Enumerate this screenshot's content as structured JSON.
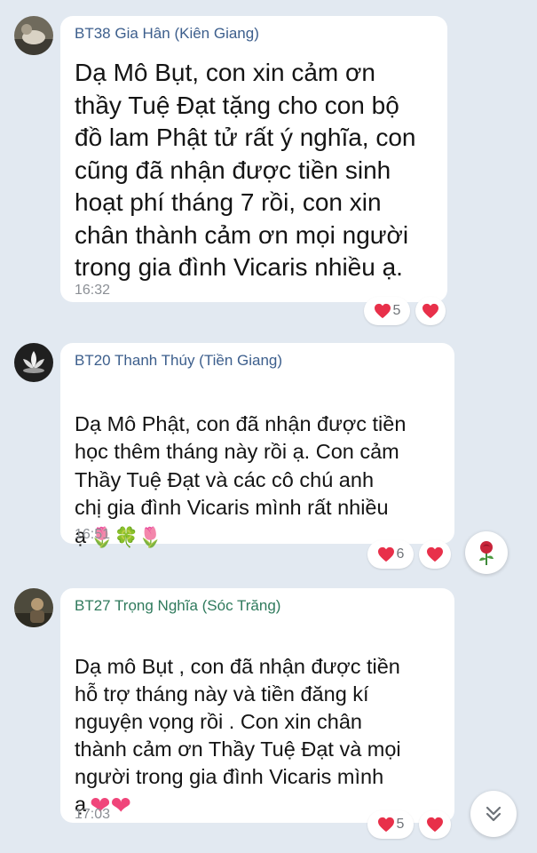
{
  "messages": [
    {
      "sender": "BT38 Gia Hân (Kiên Giang)",
      "text": "Dạ Mô Bụt, con xin cảm ơn\nthầy Tuệ Đạt tặng cho con bộ\nđồ lam Phật tử rất ý nghĩa, con\ncũng đã nhận được tiền sinh\nhoạt phí tháng 7 rồi, con xin\nchân thành cảm ơn mọi người\ntrong gia đình Vicaris nhiều ạ.",
      "time": "16:32",
      "reaction_count": "5"
    },
    {
      "sender": "BT20 Thanh Thúy (Tiền Giang)",
      "text": "Dạ Mô Phật, con đã nhận được tiền\nhọc thêm tháng này rồi ạ. Con cảm\nThầy Tuệ Đạt và các cô chú anh\nchị gia đình Vicaris mình rất nhiều\nạ",
      "emoji_text": "🌷🍀🌷",
      "time": "16:51",
      "reaction_count": "6"
    },
    {
      "sender": "BT27 Trọng Nghĩa (Sóc Trăng)",
      "text": "Dạ mô Bụt , con đã nhận được tiền\nhỗ trợ tháng này và tiền đăng kí\nnguyện vọng rồi . Con xin chân\nthành cảm ơn Thầy Tuệ Đạt và mọi\nngười trong gia đình Vicaris mình\nạ",
      "emoji_text": "❤❤",
      "time": "17:03",
      "reaction_count": "5"
    }
  ],
  "icons": {
    "reaction": "heart-icon",
    "quick_react": "rose-icon",
    "scroll": "chevron-double-down-icon"
  },
  "colors": {
    "background": "#e2e9f1",
    "bubble": "#ffffff",
    "sender": "#3c5e8c",
    "sender_green": "#2f7a5c",
    "heart": "#e8304a",
    "time": "#8b8f95"
  }
}
